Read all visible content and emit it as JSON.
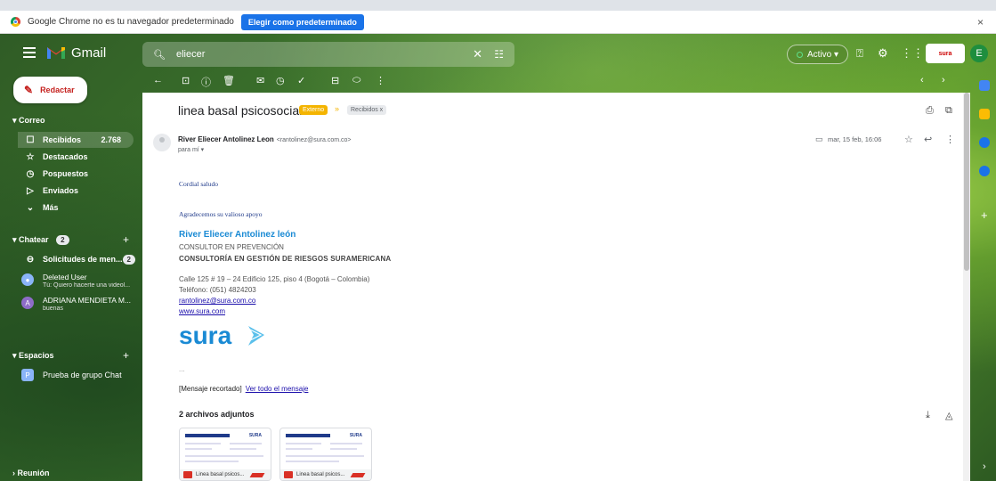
{
  "browser": {
    "infobar_text": "Google Chrome no es tu navegador predeterminado",
    "default_button": "Elegir como predeterminado",
    "close": "×"
  },
  "header": {
    "app_name": "Gmail",
    "search_query": "eliecer",
    "status": "Activo ▾",
    "org_logo_text": "sura",
    "avatar_initial": "E"
  },
  "sidebar": {
    "compose_label": "Redactar",
    "mail_section": "Correo",
    "items": [
      {
        "label": "Recibidos",
        "count": "2.768",
        "icon": "inbox-icon",
        "glyph": "☐"
      },
      {
        "label": "Destacados",
        "icon": "star-icon",
        "glyph": "☆"
      },
      {
        "label": "Pospuestos",
        "icon": "clock-icon",
        "glyph": "◷"
      },
      {
        "label": "Enviados",
        "icon": "send-icon",
        "glyph": "▷"
      },
      {
        "label": "Más",
        "icon": "chevron-down-icon",
        "glyph": "⌄"
      }
    ],
    "chat_section": "Chatear",
    "chat_count": "2",
    "chat_items": [
      {
        "label": "Solicitudes de men...",
        "badge": "2"
      }
    ],
    "contacts": [
      {
        "name": "Deleted User",
        "sub": "Tú: Quiero hacerte una videol...",
        "color": "#8ab4f8"
      },
      {
        "name": "ADRIANA MENDIETA M...",
        "sub": "buenas",
        "initial": "A",
        "color": "#8e6cc8"
      }
    ],
    "spaces_section": "Espacios",
    "spaces": [
      {
        "label": "Prueba de grupo Chat",
        "initial": "P"
      }
    ],
    "meeting_section": "Reunión"
  },
  "email": {
    "subject": "linea basal psicosocial",
    "tag_external": "Externo",
    "tag_inbox": "Recibidos x",
    "sender_name": "River Eliecer Antolinez Leon",
    "sender_email": "<rantolinez@sura.com.co>",
    "to": "para mí ▾",
    "date": "mar, 15 feb, 16:06",
    "greeting": "Cordial saludo",
    "thanks": "Agradecemos su valioso apoyo",
    "signature": {
      "name": "River Eliecer Antolinez león",
      "role": "CONSULTOR EN  PREVENCIÓN",
      "dept": "CONSULTORÍA EN GESTIÓN DE RIESGOS SURAMERICANA",
      "address": "Calle 125 # 19 – 24 Edificio 125, piso 4 (Bogotá – Colombia)",
      "phone": "Teléfono: (051) 4824203",
      "email": "rantolinez@sura.com.co",
      "web": "www.sura.com",
      "logo": "sura"
    },
    "ellipsis": "...",
    "clipped_text": "[Mensaje recortado]",
    "view_all": "Ver todo el mensaje",
    "attachments_title": "2 archivos adjuntos",
    "attachments": [
      {
        "name": "Linea basal psicos...",
        "mini_logo": "SURA"
      },
      {
        "name": "Linea basal psicos...",
        "mini_logo": "SURA"
      }
    ]
  },
  "colors": {
    "accent": "#1a73e8",
    "external_tag": "#f4b400",
    "sura_blue": "#1a8ad4"
  }
}
